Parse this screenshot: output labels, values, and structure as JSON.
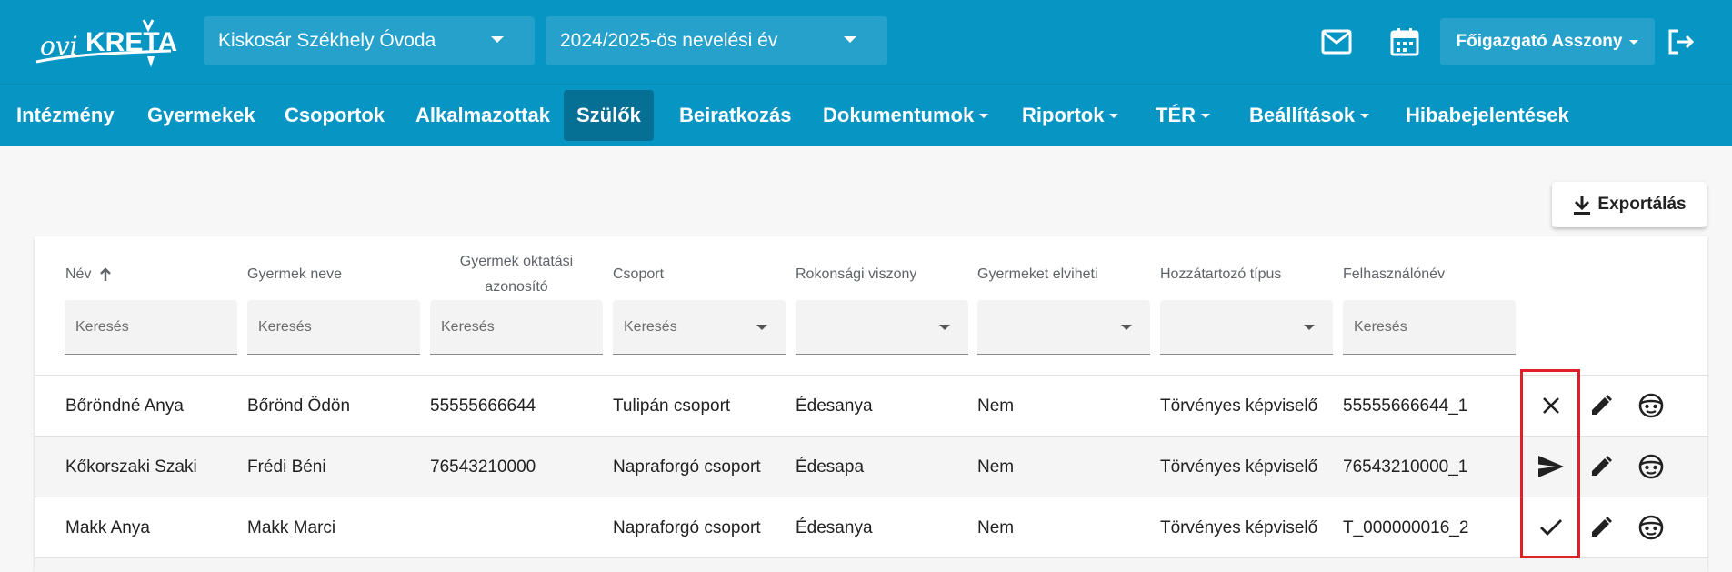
{
  "header": {
    "logo_text": "oviKRÉTA",
    "institution_select": "Kiskosár Székhely Óvoda",
    "year_select": "2024/2025-ös nevelési év",
    "user_name": "Főigazgató Asszony",
    "icons": [
      "mail-icon",
      "calendar-icon",
      "logout-icon"
    ]
  },
  "nav": {
    "items": [
      {
        "label": "Intézmény"
      },
      {
        "label": "Gyermekek"
      },
      {
        "label": "Csoportok"
      },
      {
        "label": "Alkalmazottak"
      },
      {
        "label": "Szülők",
        "active": true
      },
      {
        "label": "Beiratkozás"
      },
      {
        "label": "Dokumentumok",
        "dropdown": true
      },
      {
        "label": "Riportok",
        "dropdown": true
      },
      {
        "label": "TÉR",
        "dropdown": true
      },
      {
        "label": "Beállítások",
        "dropdown": true
      },
      {
        "label": "Hibabejelentések"
      }
    ]
  },
  "toolbar": {
    "export_label": "Exportálás"
  },
  "table": {
    "columns": [
      {
        "label": "Név",
        "sorted": "asc"
      },
      {
        "label": "Gyermek neve"
      },
      {
        "label": "Gyermek oktatási azonosító"
      },
      {
        "label": "Csoport"
      },
      {
        "label": "Rokonsági viszony"
      },
      {
        "label": "Gyermeket elviheti"
      },
      {
        "label": "Hozzátartozó típus"
      },
      {
        "label": "Felhasználónév"
      }
    ],
    "filters": [
      {
        "placeholder": "Keresés",
        "type": "text"
      },
      {
        "placeholder": "Keresés",
        "type": "text"
      },
      {
        "placeholder": "Keresés",
        "type": "text"
      },
      {
        "placeholder": "Keresés",
        "type": "select"
      },
      {
        "placeholder": "",
        "type": "select"
      },
      {
        "placeholder": "",
        "type": "select"
      },
      {
        "placeholder": "",
        "type": "select"
      },
      {
        "placeholder": "Keresés",
        "type": "text"
      }
    ],
    "rows": [
      {
        "cells": [
          "Bőröndné Anya",
          "Bőrönd Ödön",
          "55555666644",
          "Tulipán csoport",
          "Édesanya",
          "Nem",
          "Törvényes képviselő",
          "55555666644_1"
        ],
        "status_icon": "close-icon"
      },
      {
        "cells": [
          "Kőkorszaki Szaki",
          "Frédi Béni",
          "76543210000",
          "Napraforgó csoport",
          "Édesapa",
          "Nem",
          "Törvényes képviselő",
          "76543210000_1"
        ],
        "status_icon": "send-icon"
      },
      {
        "cells": [
          "Makk Anya",
          "Makk Marci",
          "",
          "Napraforgó csoport",
          "Édesanya",
          "Nem",
          "Törvényes képviselő",
          "T_000000016_2"
        ],
        "status_icon": "check-icon"
      }
    ]
  },
  "colors": {
    "primary": "#0795c4",
    "active_nav": "#066f94",
    "highlight": "#e02027"
  }
}
